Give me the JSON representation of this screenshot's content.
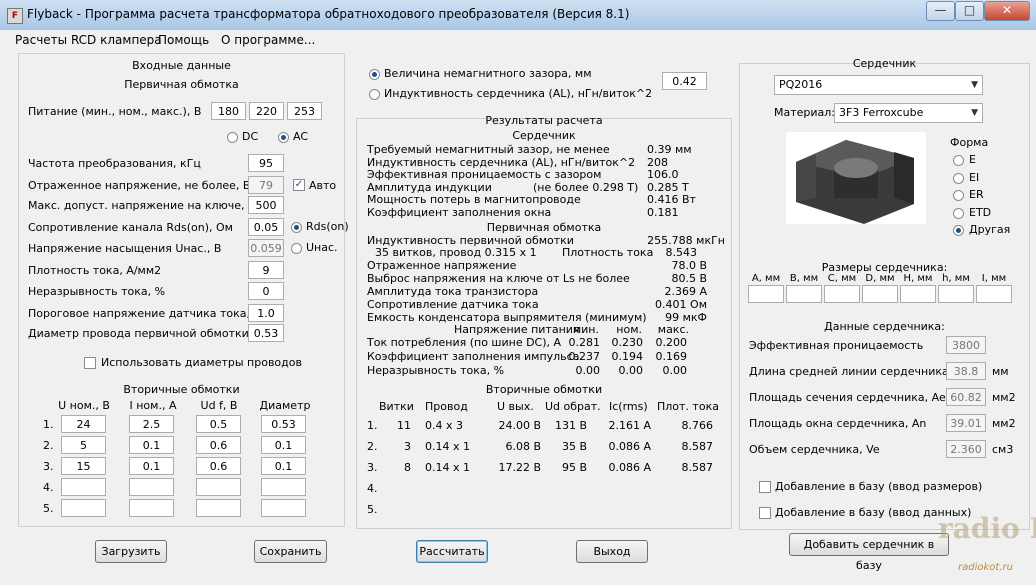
{
  "window": {
    "title": "Flyback - Программа расчета трансформатора обратноходового преобразователя (Версия 8.1)",
    "min": "—",
    "max": "□",
    "close": "✕",
    "icon": "app-icon"
  },
  "menu": [
    "Расчеты RCD клампера",
    "Помощь",
    "О программе..."
  ],
  "input": {
    "title": "Входные данные",
    "primary_title": "Первичная обмотка",
    "supply_label": "Питание (мин., ном., макс.), В",
    "supply": [
      "180",
      "220",
      "253"
    ],
    "dc": "DC",
    "ac": "AC",
    "freq_label": "Частота преобразования, кГц",
    "freq": "95",
    "refl_label": "Отраженное напряжение, не более, В",
    "refl": "79",
    "auto": "Авто",
    "vmax_label": "Макс. допуст. напряжение на ключе, В",
    "vmax": "500",
    "rds_label": "Сопротивление канала Rds(on), Ом",
    "rds": "0.05",
    "rds_opt": "Rds(on)",
    "usat_label": "Напряжение насыщения Uнас., В",
    "usat": "0.059",
    "usat_opt": "Uнас.",
    "jd_label": "Плотность тока, А/мм2",
    "jd": "9",
    "cont_label": "Неразрывность тока, %",
    "cont": "0",
    "vth_label": "Пороговое напряжение датчика тока, В",
    "vth": "1.0",
    "dwire_label": "Диаметр провода первичной обмотки",
    "dwire": "0.53",
    "use_diam": "Использовать диаметры проводов",
    "secondary_title": "Вторичные обмотки",
    "sec_headers": [
      "U ном., В",
      "I ном., А",
      "Ud f, В",
      "Диаметр"
    ],
    "sec_rows": [
      {
        "n": "1.",
        "u": "24",
        "i": "2.5",
        "ud": "0.5",
        "d": "0.53"
      },
      {
        "n": "2.",
        "u": "5",
        "i": "0.1",
        "ud": "0.6",
        "d": "0.1"
      },
      {
        "n": "3.",
        "u": "15",
        "i": "0.1",
        "ud": "0.6",
        "d": "0.1"
      },
      {
        "n": "4.",
        "u": "",
        "i": "",
        "ud": "",
        "d": ""
      },
      {
        "n": "5.",
        "u": "",
        "i": "",
        "ud": "",
        "d": ""
      }
    ]
  },
  "mid": {
    "gap_label": "Величина немагнитного зазора, мм",
    "al_label": "Индуктивность сердечника (AL), нГн/виток^2",
    "gap_value": "0.42",
    "results_title": "Результаты расчета",
    "core_title": "Сердечник",
    "core_rows": [
      {
        "l": "Требуемый немагнитный зазор, не менее",
        "v": "0.39 мм"
      },
      {
        "l": "Индуктивность сердечника (AL), нГн/виток^2",
        "v": "208"
      },
      {
        "l": "Эффективная проницаемость с зазором",
        "v": "106.0"
      },
      {
        "l": "Амплитуда индукции",
        "note": "(не более 0.298 Т)",
        "v": "0.285 Т"
      },
      {
        "l": "Мощность потерь в магнитопроводе",
        "v": "0.416 Вт"
      },
      {
        "l": "Коэффициент заполнения окна",
        "v": "0.181"
      }
    ],
    "prim_title": "Первичная обмотка",
    "prim_l_label": "Индуктивность первичной обмотки",
    "prim_l": "255.788 мкГн",
    "turns": "35 витков, провод 0.315 x 1",
    "jd_label": "Плотность тока",
    "jd_val": "8.543",
    "prim_rows": [
      {
        "l": "Отраженное напряжение",
        "v": "78.0 В"
      },
      {
        "l": "Выброс напряжения на ключе от Ls не более",
        "v": "80.5 В"
      },
      {
        "l": "Амплитуда тока транзистора",
        "v": "2.369 А"
      },
      {
        "l": "Сопротивление датчика тока",
        "v": "0.401 Ом"
      },
      {
        "l": "Емкость конденсатора выпрямителя (минимум)",
        "v": "99 мкФ"
      }
    ],
    "supply_hdr": "Напряжение питания",
    "min": "мин.",
    "nom": "ном.",
    "max": "макс.",
    "supply_rows": [
      {
        "l": "Ток потребления (по шине DC), А",
        "a": "0.281",
        "b": "0.230",
        "c": "0.200"
      },
      {
        "l": "Коэффициент заполнения импульса",
        "a": "0.237",
        "b": "0.194",
        "c": "0.169"
      },
      {
        "l": "Неразрывность тока, %",
        "a": "0.00",
        "b": "0.00",
        "c": "0.00"
      }
    ],
    "sec_title": "Вторичные обмотки",
    "sec_headers": [
      "Витки",
      "Провод",
      "U вых.",
      "Ud обрат.",
      "Ic(rms)",
      "Плот. тока"
    ],
    "sec_rows": [
      {
        "n": "1.",
        "t": "11",
        "w": "0.4 x 3",
        "u": "24.00 В",
        "ud": "131 В",
        "ic": "2.161 А",
        "j": "8.766"
      },
      {
        "n": "2.",
        "t": "3",
        "w": "0.14 x 1",
        "u": "6.08 В",
        "ud": "35 В",
        "ic": "0.086 А",
        "j": "8.587"
      },
      {
        "n": "3.",
        "t": "8",
        "w": "0.14 x 1",
        "u": "17.22 В",
        "ud": "95 В",
        "ic": "0.086 А",
        "j": "8.587"
      },
      {
        "n": "4.",
        "t": "",
        "w": "",
        "u": "",
        "ud": "",
        "ic": "",
        "j": ""
      },
      {
        "n": "5.",
        "t": "",
        "w": "",
        "u": "",
        "ud": "",
        "ic": "",
        "j": ""
      }
    ]
  },
  "core": {
    "title": "Сердечник",
    "type": "PQ2016",
    "material_label": "Материал:",
    "material": "3F3 Ferroxcube",
    "form_title": "Форма",
    "forms": [
      "E",
      "EI",
      "ER",
      "ETD",
      "Другая"
    ],
    "dims_title": "Размеры сердечника:",
    "dims": [
      "A, мм",
      "B, мм",
      "C, мм",
      "D, мм",
      "H, мм",
      "h, мм",
      "I, мм"
    ],
    "data_title": "Данные сердечника:",
    "data_rows": [
      {
        "l": "Эффективная проницаемость",
        "v": "3800",
        "u": ""
      },
      {
        "l": "Длина средней линии сердечника, le",
        "v": "38.8",
        "u": "мм"
      },
      {
        "l": "Площадь сечения сердечника, Ae",
        "v": "60.82",
        "u": "мм2"
      },
      {
        "l": "Площадь окна сердечника, An",
        "v": "39.01",
        "u": "мм2"
      },
      {
        "l": "Объем сердечника, Ve",
        "v": "2.360",
        "u": "см3"
      }
    ],
    "add_dims": "Добавление в базу (ввод размеров)",
    "add_data": "Добавление в базу (ввод данных)",
    "add_btn": "Добавить сердечник в базу"
  },
  "buttons": {
    "load": "Загрузить",
    "save": "Сохранить",
    "calc": "Рассчитать",
    "exit": "Выход"
  },
  "watermark": {
    "logo": "radio KOT",
    "site": "radiokot.ru"
  }
}
